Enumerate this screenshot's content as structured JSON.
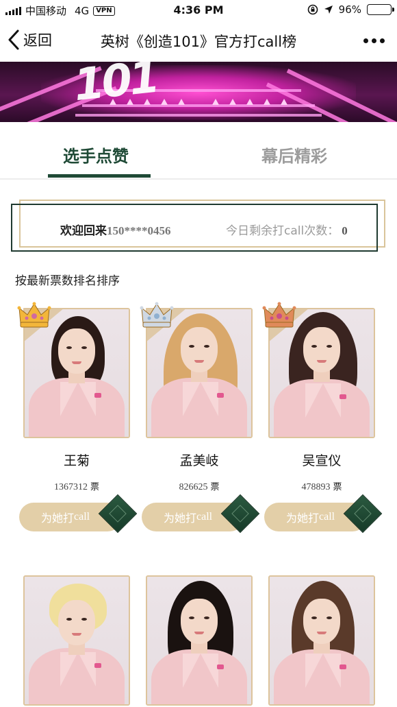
{
  "status_bar": {
    "carrier": "中国移动",
    "network": "4G",
    "vpn": "VPN",
    "time": "4:36 PM",
    "battery": "96%",
    "battery_level": 0.96
  },
  "nav": {
    "back_label": "返回",
    "title": "英树《创造101》官方打call榜"
  },
  "tabs": [
    {
      "label": "选手点赞",
      "active": true
    },
    {
      "label": "幕后精彩",
      "active": false
    }
  ],
  "welcome": {
    "greeting": "欢迎回来",
    "phone": "150****0456",
    "remaining_label": "今日剩余打call次数：",
    "remaining_count": "0"
  },
  "sort_label": "按最新票数排名排序",
  "vote_unit": "票",
  "call_button": {
    "prefix": "为她打",
    "suffix": "call"
  },
  "contestants": [
    {
      "name": "王菊",
      "votes": "1367312",
      "rank_crown": "gold-crown-icon"
    },
    {
      "name": "孟美岐",
      "votes": "826625",
      "rank_crown": "silver-crown-icon"
    },
    {
      "name": "吴宣仪",
      "votes": "478893",
      "rank_crown": "bronze-crown-icon"
    },
    {
      "name": "",
      "votes": "",
      "rank_crown": ""
    },
    {
      "name": "",
      "votes": "",
      "rank_crown": ""
    },
    {
      "name": "",
      "votes": "",
      "rank_crown": ""
    }
  ],
  "colors": {
    "accent_green": "#1f4a36",
    "gold": "#ddc49c",
    "button_beige": "#e3cfa8"
  }
}
